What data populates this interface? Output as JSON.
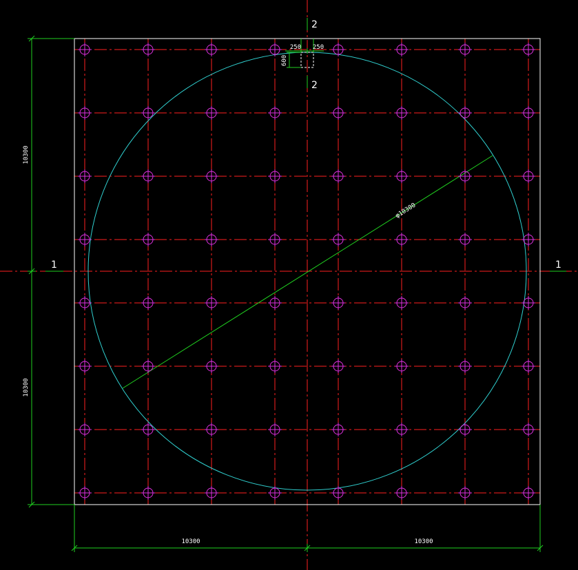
{
  "colors": {
    "background": "#000000",
    "boundary": "#ffffff",
    "grid_axis": "#ff2020",
    "pile": "#e030e0",
    "pile_cross": "#ff2020",
    "circle": "#30d0d0",
    "dimension": "#20d020",
    "text": "#ffffff"
  },
  "grid": {
    "columns": 8,
    "rows": 8
  },
  "dimensions": {
    "left_upper": "10300",
    "left_lower": "10300",
    "bottom_left": "10300",
    "bottom_right": "10300",
    "circle_diameter": "φ10300",
    "detail_width_left": "250",
    "detail_width_right": "250",
    "detail_height": "600"
  },
  "section_marks": {
    "top": "2",
    "top_below": "2",
    "left": "1",
    "right": "1"
  }
}
